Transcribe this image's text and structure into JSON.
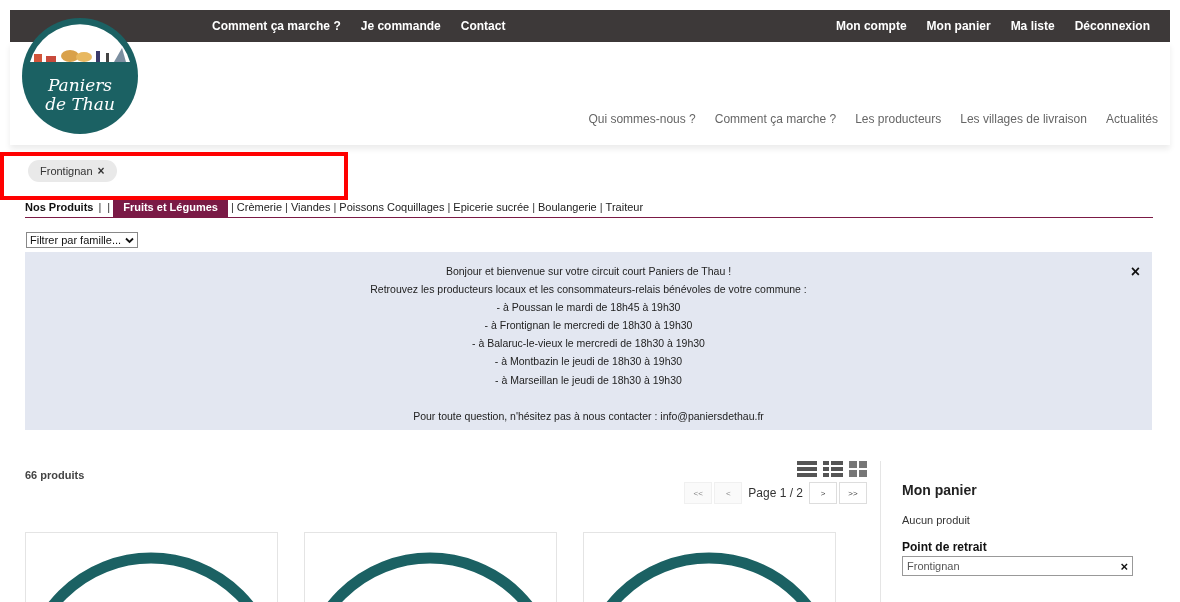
{
  "top_bar": {
    "left_links": [
      "Comment ça marche ?",
      "Je commande",
      "Contact"
    ],
    "right_links": [
      "Mon compte",
      "Mon panier",
      "Ma liste",
      "Déconnexion"
    ]
  },
  "logo": {
    "lines": [
      "Paniers",
      "de Thau"
    ]
  },
  "main_nav": [
    "Qui sommes-nous ?",
    "Comment ça marche ?",
    "Les producteurs",
    "Les villages de livraison",
    "Actualités"
  ],
  "filter_chip": {
    "label": "Frontignan",
    "remove": "×"
  },
  "category_nav": [
    {
      "kind": "heading",
      "text": "Nos Produits"
    },
    {
      "kind": "separator",
      "text": "|"
    },
    {
      "kind": "separator",
      "text": "|"
    },
    {
      "kind": "category",
      "text": "Fruits et Légumes",
      "selected": true
    },
    {
      "kind": "separator",
      "text": "|"
    },
    {
      "kind": "category",
      "text": "Crèmerie",
      "selected": false
    },
    {
      "kind": "separator",
      "text": "|"
    },
    {
      "kind": "category",
      "text": "Viandes",
      "selected": false
    },
    {
      "kind": "separator",
      "text": "|"
    },
    {
      "kind": "category",
      "text": "Poissons Coquillages",
      "selected": false
    },
    {
      "kind": "separator",
      "text": "|"
    },
    {
      "kind": "category",
      "text": "Epicerie sucrée",
      "selected": false
    },
    {
      "kind": "separator",
      "text": "|"
    },
    {
      "kind": "category",
      "text": "Boulangerie",
      "selected": false
    },
    {
      "kind": "separator",
      "text": "|"
    },
    {
      "kind": "category",
      "text": "Traiteur",
      "selected": false
    }
  ],
  "family_filter": {
    "value": "Filtrer par famille..."
  },
  "notice": {
    "close": "×",
    "lines": [
      "Bonjour et bienvenue sur votre circuit  court Paniers de Thau !",
      "Retrouvez les producteurs locaux et les consommateurs-relais bénévoles de votre commune :",
      "- à Poussan le mardi de 18h45 à 19h30",
      "- à Frontignan le mercredi de 18h30 à 19h30",
      "- à Balaruc-le-vieux le mercredi de 18h30 à 19h30",
      "- à Montbazin le jeudi de 18h30 à 19h30",
      "- à Marseillan le jeudi de 18h30 à 19h30"
    ],
    "contact": "Pour toute question, n'hésitez pas à nous contacter : info@paniersdethau.fr"
  },
  "product_count": "66 produits",
  "pagination": {
    "buttons": [
      {
        "label": "<<",
        "disabled": true
      },
      {
        "label": "<",
        "disabled": true
      }
    ],
    "page": "Page 1 / 2",
    "next_buttons": [
      {
        "label": ">",
        "disabled": false
      },
      {
        "label": ">>",
        "disabled": false
      }
    ]
  },
  "products": [
    {
      "kind": "placeholder"
    },
    {
      "kind": "placeholder"
    },
    {
      "kind": "placeholder"
    }
  ],
  "cart": {
    "title": "Mon panier",
    "empty": "Aucun produit",
    "pickup_label": "Point de retrait",
    "pickup_value": "Frontignan",
    "clear": "×"
  }
}
